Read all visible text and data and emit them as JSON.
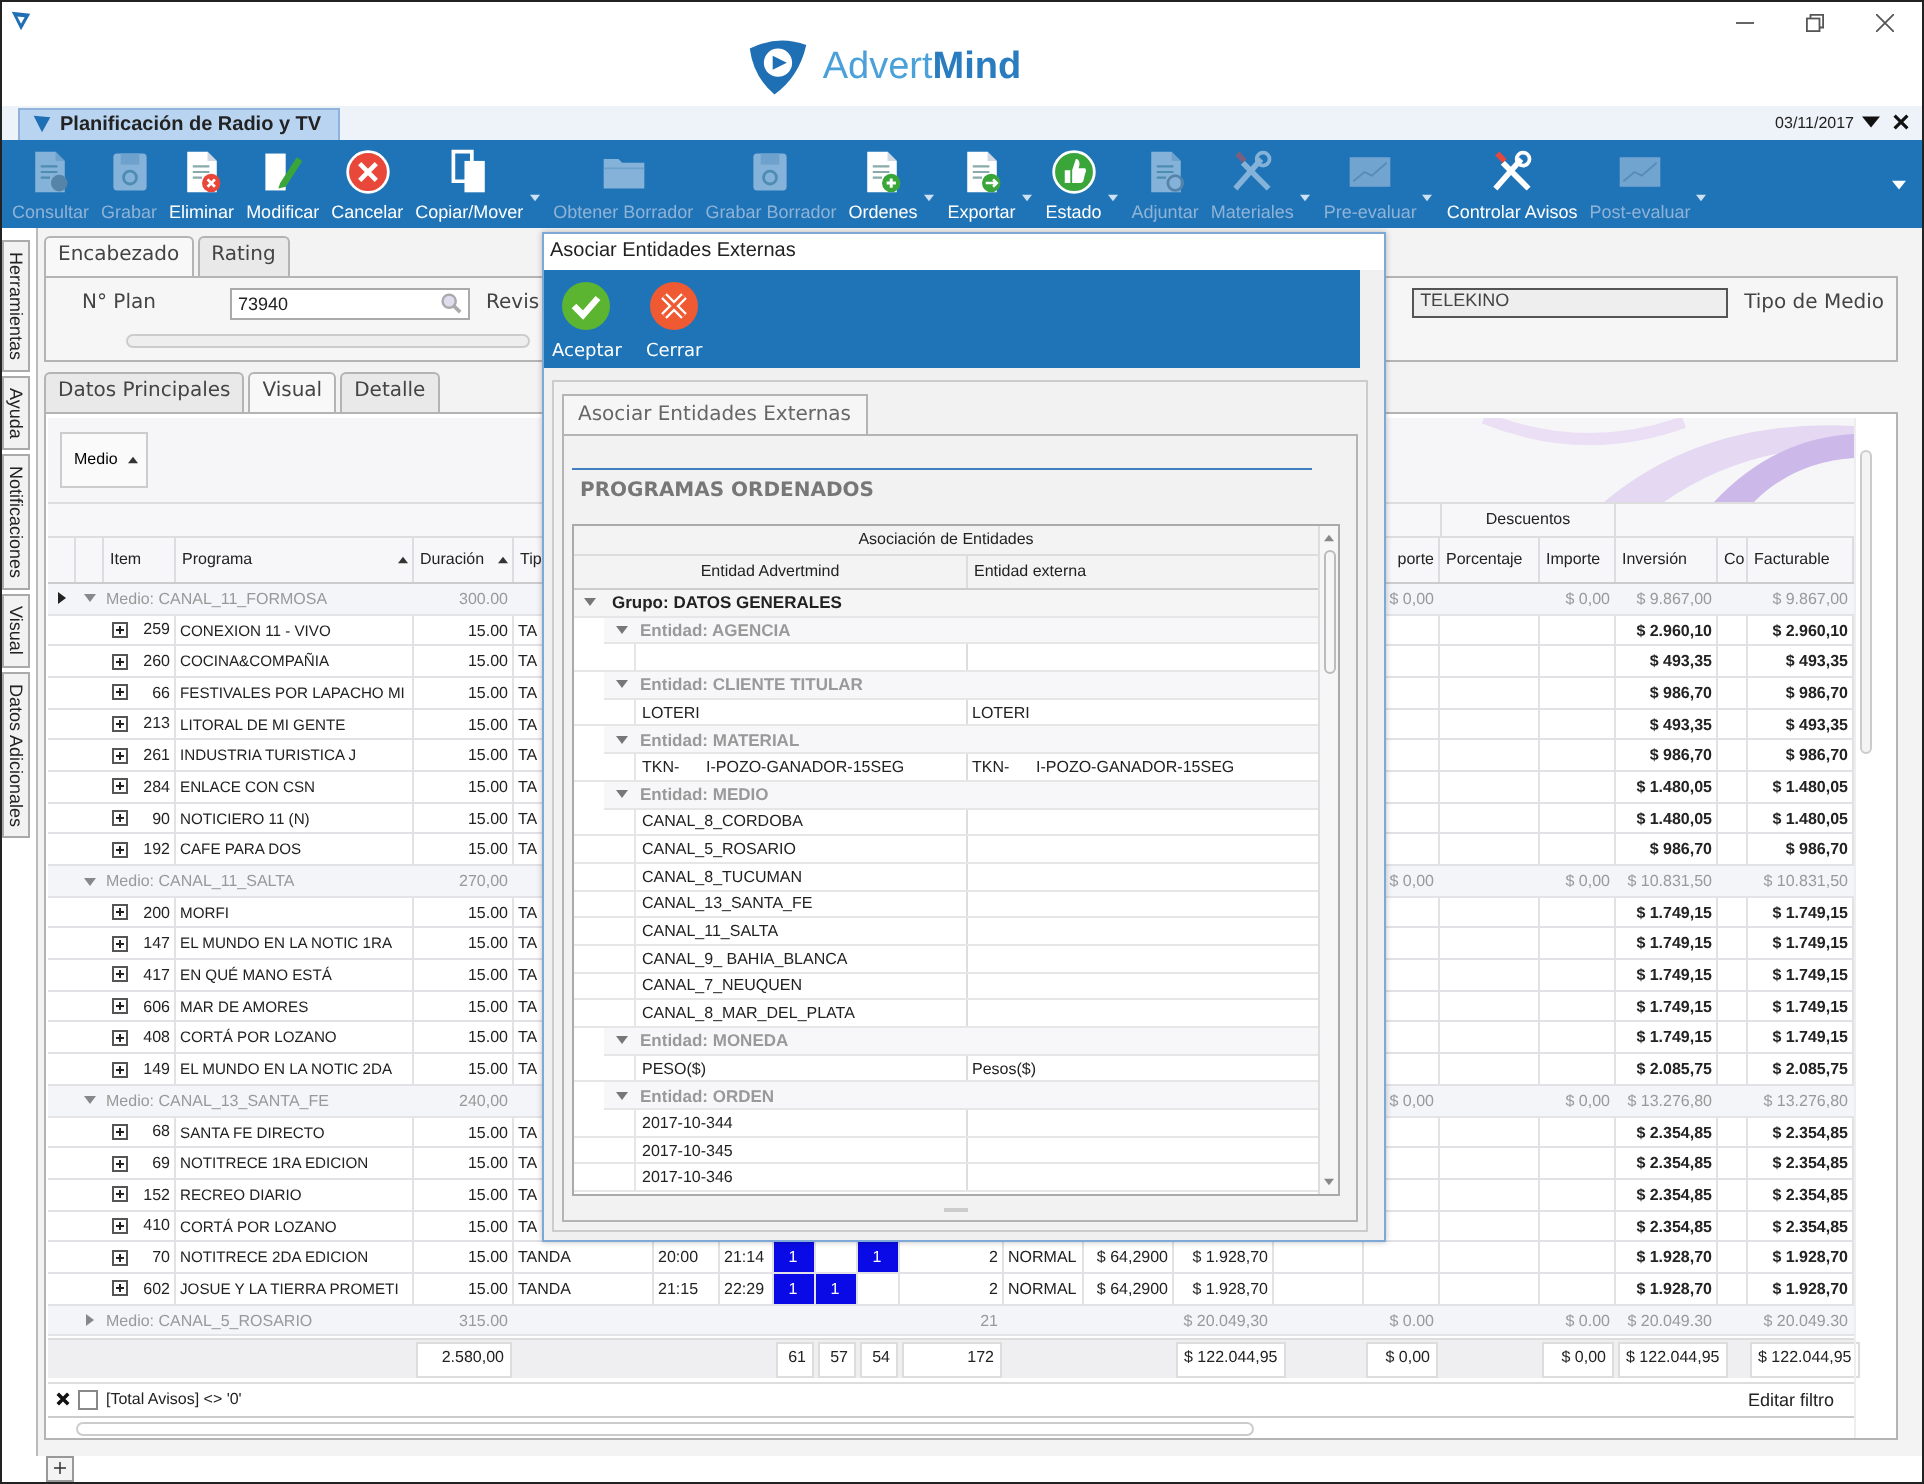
{
  "app": {
    "logo": "Advert**Mind**"
  },
  "document_tab": {
    "title": "Planificación de Radio y TV",
    "date": "03/11/2017"
  },
  "toolbar": [
    {
      "label": "Consultar",
      "kind": "doc-search",
      "disabled": true,
      "dropdown": false
    },
    {
      "label": "Grabar",
      "kind": "save",
      "disabled": true,
      "dropdown": false
    },
    {
      "label": "Eliminar",
      "kind": "doc-delete",
      "disabled": false,
      "dropdown": false
    },
    {
      "label": "Modificar",
      "kind": "edit",
      "disabled": false,
      "dropdown": false
    },
    {
      "label": "Cancelar",
      "kind": "cancel",
      "disabled": false,
      "dropdown": false
    },
    {
      "label": "Copiar/Mover",
      "kind": "copy",
      "disabled": false,
      "dropdown": true
    },
    {
      "label": "Obtener Borrador",
      "kind": "folder",
      "disabled": true,
      "dropdown": false
    },
    {
      "label": "Grabar Borrador",
      "kind": "save",
      "disabled": true,
      "dropdown": false
    },
    {
      "label": "Ordenes",
      "kind": "doc-add",
      "disabled": false,
      "dropdown": true
    },
    {
      "label": "Exportar",
      "kind": "doc-export",
      "disabled": false,
      "dropdown": true
    },
    {
      "label": "Estado",
      "kind": "thumb",
      "disabled": false,
      "dropdown": true
    },
    {
      "label": "Adjuntar",
      "kind": "doc-clip",
      "disabled": true,
      "dropdown": false
    },
    {
      "label": "Materiales",
      "kind": "tools",
      "disabled": true,
      "dropdown": true
    },
    {
      "label": "Pre-evaluar",
      "kind": "chart",
      "disabled": true,
      "dropdown": true
    },
    {
      "label": "Controlar Avisos",
      "kind": "tools",
      "disabled": false,
      "dropdown": false
    },
    {
      "label": "Post-evaluar",
      "kind": "chart",
      "disabled": true,
      "dropdown": true
    }
  ],
  "side_tabs": [
    "Herramientas",
    "Ayuda",
    "Notificaciones",
    "Visual",
    "Datos Adicionales"
  ],
  "header_tabs": [
    {
      "label": "Encabezado",
      "selected": true
    },
    {
      "label": "Rating",
      "selected": false
    }
  ],
  "plan": {
    "label": "N° Plan",
    "value": "73940",
    "revision_label": "Revis",
    "cliente": "TELEKINO",
    "tipo_medio_label": "Tipo de Medio"
  },
  "view_tabs": [
    {
      "label": "Datos Principales",
      "selected": false
    },
    {
      "label": "Visual",
      "selected": true
    },
    {
      "label": "Detalle",
      "selected": false
    }
  ],
  "grid": {
    "group_by": {
      "label": "Medio",
      "sorted": true
    },
    "band": "Descuentos",
    "columns": [
      {
        "label": "Item"
      },
      {
        "label": "Programa",
        "sorted": true
      },
      {
        "label": "Duración",
        "sorted": true
      },
      {
        "label": "Tip"
      },
      {
        "label": "porte"
      },
      {
        "label": "Porcentaje"
      },
      {
        "label": "Importe"
      },
      {
        "label": "Inversión"
      },
      {
        "label": "Co"
      },
      {
        "label": "Facturable"
      }
    ],
    "groups": [
      {
        "label": "Medio: CANAL_11_FORMOSA",
        "current": true,
        "expanded": true,
        "duracion": "300.00",
        "importe_2": "$ 0,00",
        "descuento_importe": "$ 0,00",
        "inversion": "$ 9.867,00",
        "facturable": "$ 9.867,00",
        "rows": [
          {
            "item": "259",
            "programa": "CONEXION 11 - VIVO",
            "duracion": "15.00",
            "tipo": "TA",
            "inversion": "$ 2.960,10",
            "facturable": "$ 2.960,10"
          },
          {
            "item": "260",
            "programa": "COCINA&COMPAÑIA",
            "duracion": "15.00",
            "tipo": "TA",
            "inversion": "$ 493,35",
            "facturable": "$ 493,35"
          },
          {
            "item": "66",
            "programa": "FESTIVALES POR LAPACHO MI",
            "duracion": "15.00",
            "tipo": "TA",
            "inversion": "$ 986,70",
            "facturable": "$ 986,70"
          },
          {
            "item": "213",
            "programa": "LITORAL DE MI GENTE",
            "duracion": "15.00",
            "tipo": "TA",
            "inversion": "$ 493,35",
            "facturable": "$ 493,35"
          },
          {
            "item": "261",
            "programa": "INDUSTRIA TURISTICA J",
            "duracion": "15.00",
            "tipo": "TA",
            "inversion": "$ 986,70",
            "facturable": "$ 986,70"
          },
          {
            "item": "284",
            "programa": "ENLACE CON CSN",
            "duracion": "15.00",
            "tipo": "TA",
            "inversion": "$ 1.480,05",
            "facturable": "$ 1.480,05"
          },
          {
            "item": "90",
            "programa": "NOTICIERO 11 (N)",
            "duracion": "15.00",
            "tipo": "TA",
            "inversion": "$ 1.480,05",
            "facturable": "$ 1.480,05"
          },
          {
            "item": "192",
            "programa": "CAFE PARA DOS",
            "duracion": "15.00",
            "tipo": "TA",
            "inversion": "$ 986,70",
            "facturable": "$ 986,70"
          }
        ]
      },
      {
        "label": "Medio: CANAL_11_SALTA",
        "current": false,
        "expanded": true,
        "duracion": "270,00",
        "importe_2": "$ 0,00",
        "descuento_importe": "$ 0,00",
        "inversion": "$ 10.831,50",
        "facturable": "$ 10.831,50",
        "rows": [
          {
            "item": "200",
            "programa": "MORFI",
            "duracion": "15.00",
            "tipo": "TA",
            "inversion": "$ 1.749,15",
            "facturable": "$ 1.749,15"
          },
          {
            "item": "147",
            "programa": "EL MUNDO EN LA NOTIC 1RA",
            "duracion": "15.00",
            "tipo": "TA",
            "inversion": "$ 1.749,15",
            "facturable": "$ 1.749,15"
          },
          {
            "item": "417",
            "programa": "EN QUÉ MANO ESTÁ",
            "duracion": "15.00",
            "tipo": "TA",
            "inversion": "$ 1.749,15",
            "facturable": "$ 1.749,15"
          },
          {
            "item": "606",
            "programa": "MAR DE AMORES",
            "duracion": "15.00",
            "tipo": "TA",
            "inversion": "$ 1.749,15",
            "facturable": "$ 1.749,15"
          },
          {
            "item": "408",
            "programa": "CORTÁ POR LOZANO",
            "duracion": "15.00",
            "tipo": "TA",
            "inversion": "$ 1.749,15",
            "facturable": "$ 1.749,15"
          },
          {
            "item": "149",
            "programa": "EL MUNDO EN LA NOTIC 2DA",
            "duracion": "15.00",
            "tipo": "TA",
            "inversion": "$ 2.085,75",
            "facturable": "$ 2.085,75"
          }
        ]
      },
      {
        "label": "Medio: CANAL_13_SANTA_FE",
        "current": false,
        "expanded": true,
        "duracion": "240,00",
        "importe_2": "$ 0,00",
        "descuento_importe": "$ 0,00",
        "inversion": "$ 13.276,80",
        "facturable": "$ 13.276,80",
        "rows": [
          {
            "item": "68",
            "programa": "SANTA FE DIRECTO",
            "duracion": "15.00",
            "tipo": "TA",
            "inversion": "$ 2.354,85",
            "facturable": "$ 2.354,85"
          },
          {
            "item": "69",
            "programa": "NOTITRECE 1RA EDICION",
            "duracion": "15.00",
            "tipo": "TA",
            "inversion": "$ 2.354,85",
            "facturable": "$ 2.354,85"
          },
          {
            "item": "152",
            "programa": "RECREO DIARIO",
            "duracion": "15.00",
            "tipo": "TA",
            "inversion": "$ 2.354,85",
            "facturable": "$ 2.354,85"
          },
          {
            "item": "410",
            "programa": "CORTÁ POR LOZANO",
            "duracion": "15.00",
            "tipo": "TA",
            "inversion": "$ 2.354,85",
            "facturable": "$ 2.354,85"
          },
          {
            "item": "70",
            "programa": "NOTITRECE 2DA EDICION",
            "duracion": "15.00",
            "tipo": "TANDA",
            "hora_inicio": "20:00",
            "hora_fin": "21:14",
            "dias": [
              {
                "on": true,
                "text": "1"
              },
              {
                "on": false
              },
              {
                "on": true,
                "text": "1"
              }
            ],
            "cantidad": "2",
            "modalidad": "NORMAL",
            "tarifa": "$ 64,2900",
            "importe": "$ 1.928,70",
            "inversion": "$ 1.928,70",
            "facturable": "$ 1.928,70"
          },
          {
            "item": "602",
            "programa": "JOSUE Y LA TIERRA PROMETI",
            "duracion": "15.00",
            "tipo": "TANDA",
            "hora_inicio": "21:15",
            "hora_fin": "22:29",
            "dias": [
              {
                "on": true,
                "text": "1"
              },
              {
                "on": true,
                "text": "1"
              },
              {
                "on": false
              }
            ],
            "cantidad": "2",
            "modalidad": "NORMAL",
            "tarifa": "$ 64,2900",
            "importe": "$ 1.928,70",
            "inversion": "$ 1.928,70",
            "facturable": "$ 1.928,70"
          }
        ]
      },
      {
        "label": "Medio: CANAL_5_ROSARIO",
        "current": false,
        "expanded": false,
        "duracion": "315.00",
        "cantidad": "21",
        "importe": "$ 20.049,30",
        "importe_2": "$ 0.00",
        "descuento_importe": "$ 0.00",
        "inversion": "$ 20.049.30",
        "facturable": "$ 20.049.30"
      }
    ],
    "totals": {
      "duracion": "2.580,00",
      "dia_1": "61",
      "dia_2": "57",
      "dia_3": "54",
      "cantidad": "172",
      "importe": "$ 122.044,95",
      "importe_2": "$ 0,00",
      "descuento_importe": "$ 0,00",
      "inversion": "$ 122.044,95",
      "facturable": "$ 122.044,95"
    },
    "filter": {
      "text": "[Total Avisos] <> '0'",
      "enabled": false
    },
    "edit_filter": "Editar filtro"
  },
  "dialog": {
    "title": "Asociar Entidades Externas",
    "actions": [
      {
        "label": "Aceptar",
        "kind": "accept"
      },
      {
        "label": "Cerrar",
        "kind": "close"
      }
    ],
    "tab": "Asociar Entidades Externas",
    "section": "PROGRAMAS ORDENADOS",
    "band": "Asociación de Entidades",
    "columns": [
      "Entidad Advertmind",
      "Entidad externa"
    ],
    "groups": [
      {
        "label": "Grupo: DATOS GENERALES",
        "expanded": true,
        "entities": [
          {
            "label": "Entidad: AGENCIA",
            "expanded": true,
            "rows": [
              {}
            ]
          },
          {
            "label": "Entidad: CLIENTE TITULAR",
            "expanded": true,
            "rows": [
              {
                "advertmind": "LOTERI",
                "externa": "LOTERI"
              }
            ]
          },
          {
            "label": "Entidad: MATERIAL",
            "expanded": true,
            "rows": [
              {
                "advertmind": "TKN-      I-POZO-GANADOR-15SEG",
                "externa": "TKN-      I-POZO-GANADOR-15SEG"
              }
            ]
          },
          {
            "label": "Entidad: MEDIO",
            "expanded": true,
            "rows": [
              {
                "advertmind": "CANAL_8_CORDOBA"
              },
              {
                "advertmind": "CANAL_5_ROSARIO"
              },
              {
                "advertmind": "CANAL_8_TUCUMAN"
              },
              {
                "advertmind": "CANAL_13_SANTA_FE"
              },
              {
                "advertmind": "CANAL_11_SALTA"
              },
              {
                "advertmind": "CANAL_9_ BAHIA_BLANCA"
              },
              {
                "advertmind": "CANAL_7_NEUQUEN"
              },
              {
                "advertmind": "CANAL_8_MAR_DEL_PLATA"
              }
            ]
          },
          {
            "label": "Entidad: MONEDA",
            "expanded": true,
            "rows": [
              {
                "advertmind": "PESO($)",
                "externa": "Pesos($)"
              }
            ]
          },
          {
            "label": "Entidad: ORDEN",
            "expanded": true,
            "rows": [
              {
                "advertmind": "2017-10-344"
              },
              {
                "advertmind": "2017-10-345"
              },
              {
                "advertmind": "2017-10-346"
              }
            ]
          }
        ]
      }
    ]
  }
}
